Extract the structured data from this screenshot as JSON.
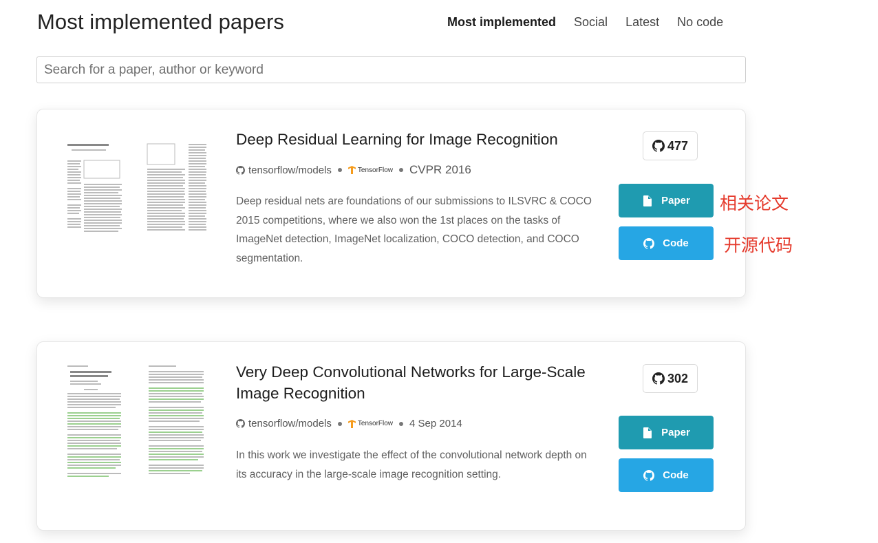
{
  "page": {
    "title": "Most implemented papers"
  },
  "tabs": [
    {
      "label": "Most implemented",
      "active": true
    },
    {
      "label": "Social",
      "active": false
    },
    {
      "label": "Latest",
      "active": false
    },
    {
      "label": "No code",
      "active": false
    }
  ],
  "search": {
    "placeholder": "Search for a paper, author or keyword",
    "value": ""
  },
  "papers": [
    {
      "title": "Deep Residual Learning for Image Recognition",
      "repo": "tensorflow/models",
      "framework": "TensorFlow",
      "venue": "CVPR 2016",
      "abstract": "Deep residual nets are foundations of our submissions to ILSVRC & COCO 2015 competitions, where we also won the 1st places on the tasks of ImageNet detection, ImageNet localization, COCO detection, and COCO segmentation.",
      "stars": "477",
      "paper_label": "Paper",
      "code_label": "Code",
      "thumbnail_icon": "paper-thumbnail-icon"
    },
    {
      "title": "Very Deep Convolutional Networks for Large-Scale Image Recognition",
      "repo": "tensorflow/models",
      "framework": "TensorFlow",
      "venue": "4 Sep 2014",
      "abstract": "In this work we investigate the effect of the convolutional network depth on its accuracy in the large-scale image recognition setting.",
      "stars": "302",
      "paper_label": "Paper",
      "code_label": "Code",
      "thumbnail_icon": "paper-thumbnail-icon"
    }
  ],
  "annotations": {
    "paper": "相关论文",
    "code": "开源代码"
  },
  "colors": {
    "paper_button": "#1f9bb0",
    "code_button": "#26a6e4",
    "annotation": "#e53a2c",
    "tensorflow": "#f59b1c"
  }
}
